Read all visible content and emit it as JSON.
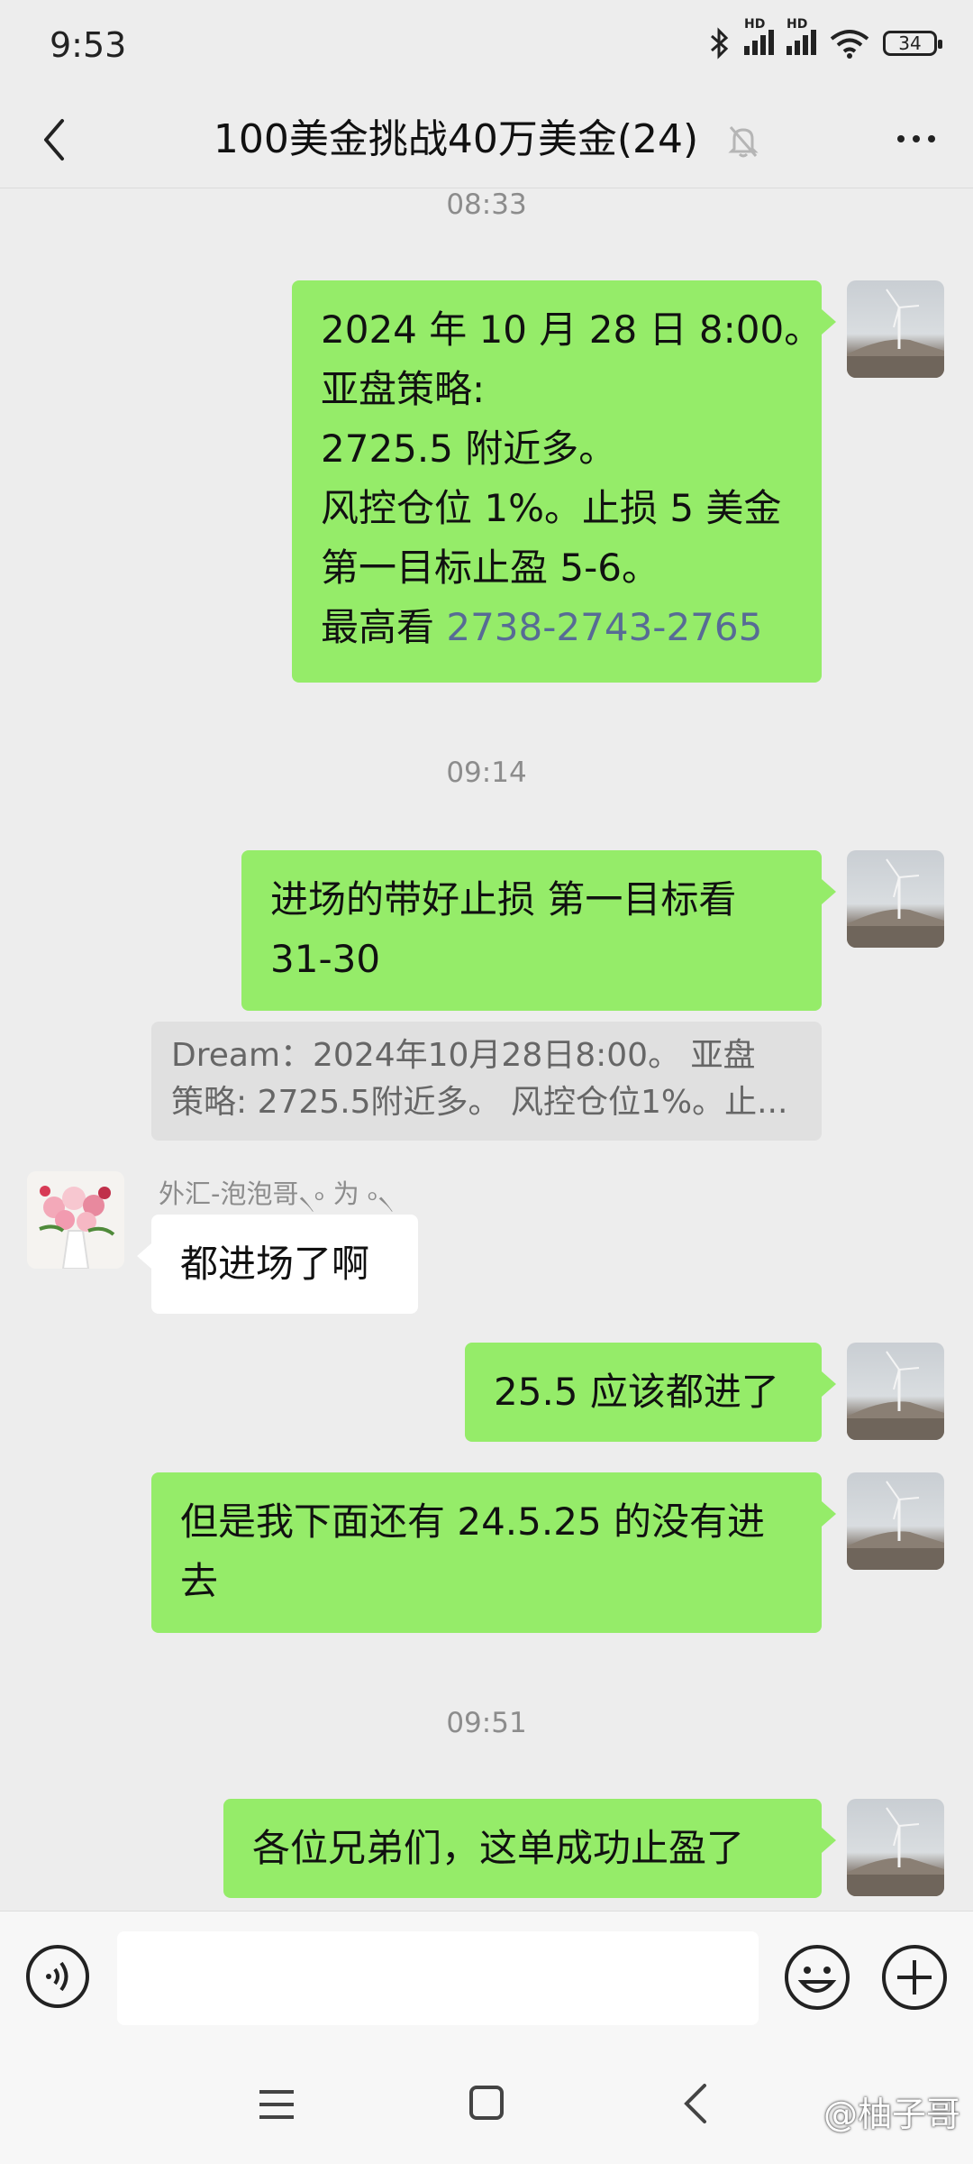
{
  "status": {
    "time": "9:53",
    "signal1": "HD",
    "signal2": "HD",
    "battery": "34"
  },
  "header": {
    "title": "100美金挑战40万美金(24)"
  },
  "chat": {
    "ts1": "08:33",
    "msg1": {
      "lines": [
        "2024 年 10 月 28 日 8:00。",
        "亚盘策略:",
        "2725.5 附近多。",
        "风控仓位 1%。止损 5 美金",
        "第一目标止盈 5-6。"
      ],
      "last_prefix": "最高看 ",
      "last_link": "2738-2743-2765"
    },
    "ts2": "09:14",
    "msg2": {
      "lines": [
        "进场的带好止损  第一目标看",
        "31-30"
      ]
    },
    "quote": {
      "lines": [
        "Dream：2024年10月28日8:00。 亚盘",
        "策略: 2725.5附近多。 风控仓位1%。止..."
      ]
    },
    "msg3": {
      "sender": "外汇-泡泡哥৲৹ 为 ৹৲",
      "text": "都进场了啊"
    },
    "msg4": {
      "text": "25.5 应该都进了"
    },
    "msg5": {
      "lines": [
        "但是我下面还有 24.5.25 的没有进",
        "去"
      ]
    },
    "ts3": "09:51",
    "msg6": {
      "text": "各位兄弟们，这单成功止盈了"
    }
  },
  "input": {
    "placeholder": ""
  },
  "watermark": "@柚子哥",
  "icons": [
    "back-arrow-icon",
    "mute-bell-icon",
    "more-icon",
    "voice-icon",
    "emoji-icon",
    "plus-icon",
    "menu-icon",
    "home-icon",
    "nav-back-icon"
  ]
}
